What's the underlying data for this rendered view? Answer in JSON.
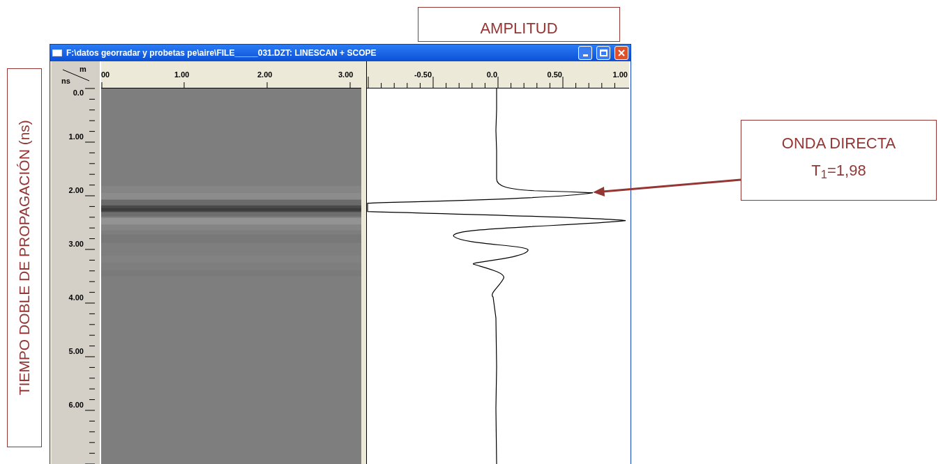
{
  "annotations": {
    "amplitude_label": "AMPLITUD",
    "time_axis_label": "TIEMPO DOBLE DE PROPAGACIÓN (ns)",
    "direct_wave": {
      "title": "ONDA DIRECTA",
      "value": "T$_{1}$=1,98"
    }
  },
  "window": {
    "title": "F:\\datos georradar y probetas pe\\aire\\FILE_____031.DZT: LINESCAN + SCOPE"
  },
  "corner": {
    "top_unit": "m",
    "side_unit": "ns"
  },
  "distance_ticks": [
    "00",
    "1.00",
    "2.00",
    "3.00"
  ],
  "amplitude_ticks": [
    "-0.50",
    "0.0",
    "0.50",
    "1.00"
  ],
  "time_ticks": [
    "0.0",
    "1.00",
    "2.00",
    "3.00",
    "4.00",
    "5.00",
    "6.00"
  ]
}
